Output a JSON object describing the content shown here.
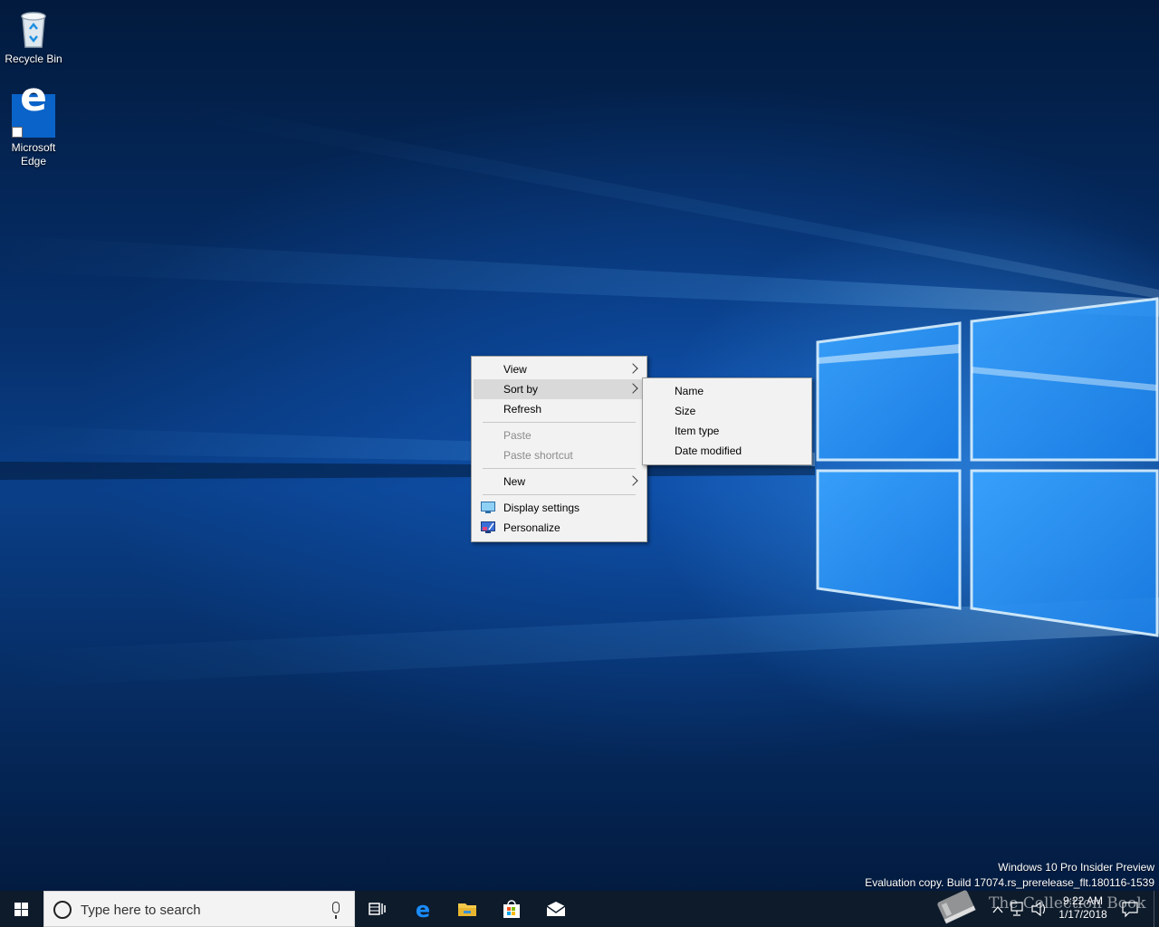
{
  "desktop": {
    "icons": [
      {
        "label": "Recycle Bin",
        "icon": "recycle-bin-icon"
      },
      {
        "label": "Microsoft\nEdge",
        "label_line1": "Microsoft",
        "label_line2": "Edge",
        "icon": "edge-icon"
      }
    ]
  },
  "context_menu": {
    "items": [
      {
        "label": "View",
        "submenu": true
      },
      {
        "label": "Sort by",
        "submenu": true,
        "highlighted": true
      },
      {
        "label": "Refresh"
      },
      {
        "label": "Paste",
        "disabled": true
      },
      {
        "label": "Paste shortcut",
        "disabled": true
      },
      {
        "label": "New",
        "submenu": true
      },
      {
        "label": "Display settings",
        "icon": "display-settings-icon"
      },
      {
        "label": "Personalize",
        "icon": "personalize-icon"
      }
    ]
  },
  "sort_submenu": {
    "items": [
      {
        "label": "Name"
      },
      {
        "label": "Size"
      },
      {
        "label": "Item type"
      },
      {
        "label": "Date modified"
      }
    ]
  },
  "watermark": {
    "line1": "Windows 10 Pro Insider Preview",
    "line2": "Evaluation copy. Build 17074.rs_prerelease_flt.180116-1539"
  },
  "taskbar": {
    "search_placeholder": "Type here to search",
    "apps": [
      "task-view-icon",
      "edge-icon",
      "file-explorer-icon",
      "store-icon",
      "mail-icon"
    ],
    "overlay_text": "The Collection Book",
    "clock": {
      "time": "9:22 AM",
      "date": "1/17/2018"
    }
  },
  "colors": {
    "taskbar": "#0e1b2b",
    "menu_bg": "#f2f2f2",
    "menu_highlight": "#d9d9d9",
    "accent": "#0a63c9"
  }
}
